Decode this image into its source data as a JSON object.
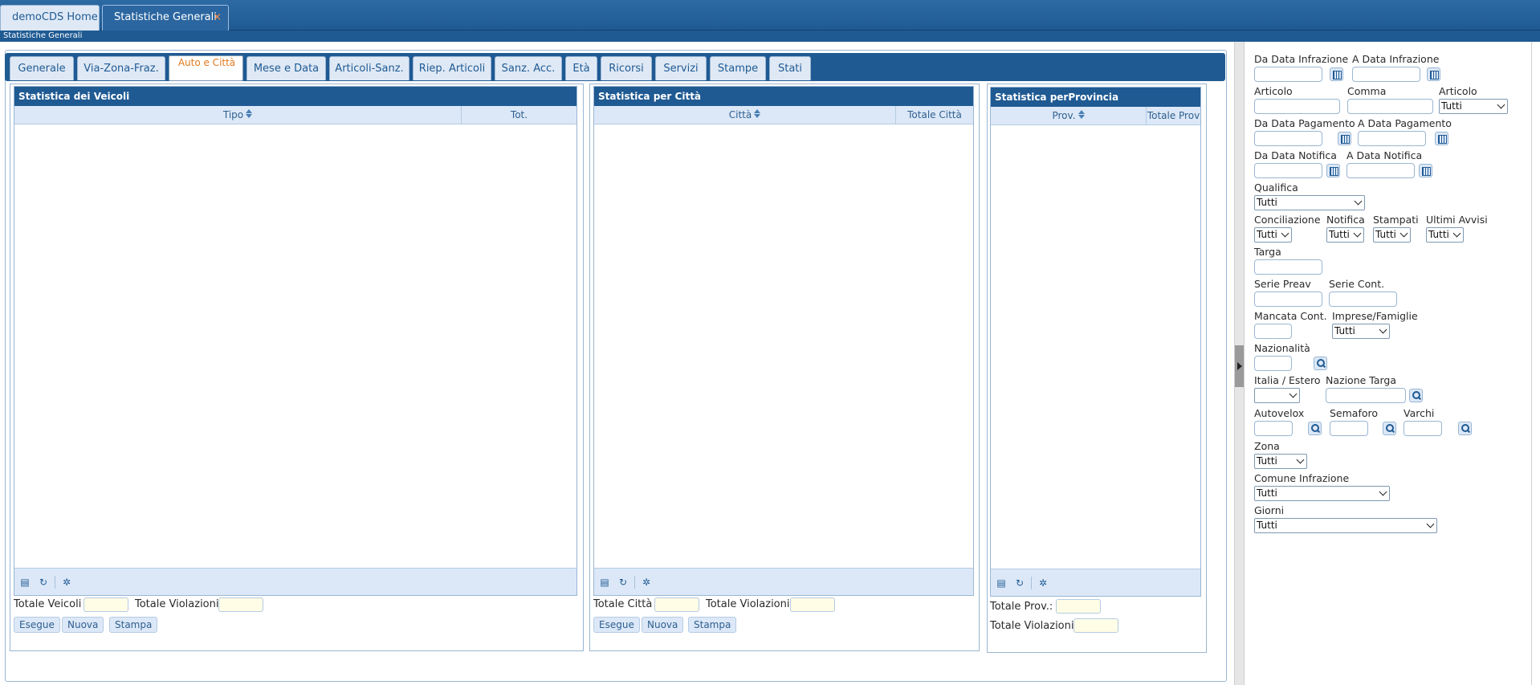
{
  "window_tabs": [
    {
      "label": "demoCDS Home"
    },
    {
      "label": "Statistiche Generali",
      "close": "×"
    }
  ],
  "subheader": "Statistiche Generali",
  "page_tabs": [
    {
      "label": "Generale"
    },
    {
      "label": "Via-Zona-Fraz."
    },
    {
      "label": "Auto e Città",
      "selected": true
    },
    {
      "label": "Mese e Data"
    },
    {
      "label": "Articoli-Sanz."
    },
    {
      "label": "Riep. Articoli"
    },
    {
      "label": "Sanz. Acc."
    },
    {
      "label": "Età"
    },
    {
      "label": "Ricorsi"
    },
    {
      "label": "Servizi"
    },
    {
      "label": "Stampe"
    },
    {
      "label": "Stati"
    }
  ],
  "veicoli": {
    "title": "Statistica dei Veicoli",
    "columns": [
      "Tipo",
      "Tot."
    ],
    "totale_label": "Totale Veicoli",
    "violazioni_label": "Totale Violazioni",
    "buttons": [
      "Esegue",
      "Nuova",
      "Stampa"
    ]
  },
  "citta": {
    "title": "Statistica per Città",
    "columns": [
      "Città",
      "Totale Città"
    ],
    "totale_label": "Totale Città",
    "violazioni_label": "Totale Violazioni",
    "buttons": [
      "Esegue",
      "Nuova",
      "Stampa"
    ]
  },
  "provincia": {
    "title": "Statistica perProvincia",
    "columns": [
      "Prov.",
      "Totale Prov"
    ],
    "totale_label": "Totale Prov.:",
    "violazioni_label": "Totale Violazioni"
  },
  "filters": {
    "da_data_infrazione": "Da Data Infrazione",
    "a_data_infrazione": "A Data Infrazione",
    "articolo": "Articolo",
    "comma": "Comma",
    "articolo2": "Articolo",
    "articolo2_value": "Tutti",
    "da_data_pagamento": "Da Data Pagamento",
    "a_data_pagamento": "A Data Pagamento",
    "da_data_notifica": "Da Data Notifica",
    "a_data_notifica": "A Data Notifica",
    "qualifica": "Qualifica",
    "qualifica_value": "Tutti",
    "conciliazione": "Conciliazione",
    "conciliazione_value": "Tutti",
    "notifica": "Notifica",
    "notifica_value": "Tutti",
    "stampati": "Stampati",
    "stampati_value": "Tutti",
    "ultimi_avvisi": "Ultimi Avvisi",
    "ultimi_avvisi_value": "Tutti",
    "targa": "Targa",
    "serie_preav": "Serie Preav",
    "serie_cont": "Serie Cont.",
    "mancata_cont": "Mancata Cont.",
    "imprese_famiglie": "Imprese/Famiglie",
    "imprese_famiglie_value": "Tutti",
    "nazionalita": "Nazionalità",
    "italia_estero": "Italia / Estero",
    "italia_estero_value": "",
    "nazione_targa": "Nazione Targa",
    "autovelox": "Autovelox",
    "semaforo": "Semaforo",
    "varchi": "Varchi",
    "zona": "Zona",
    "zona_value": "Tutti",
    "comune_infrazione": "Comune Infrazione",
    "comune_infrazione_value": "Tutti",
    "giorni": "Giorni",
    "giorni_value": "Tutti"
  },
  "colors": {
    "header_blue": "#1f5a93",
    "tab_light": "#dfe9f5",
    "selected_tab_text": "#e07a20",
    "close_orange": "#ff8c42",
    "total_box": "#fffde6"
  }
}
